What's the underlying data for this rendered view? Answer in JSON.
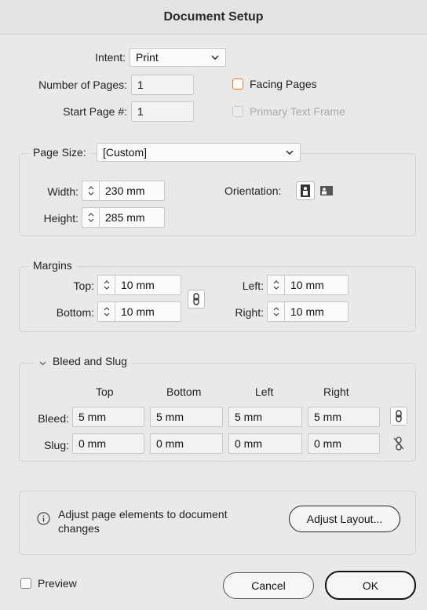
{
  "window": {
    "title": "Document Setup"
  },
  "intent": {
    "label": "Intent:",
    "value": "Print"
  },
  "pages": {
    "number_label": "Number of Pages:",
    "number_value": "1",
    "start_label": "Start Page #:",
    "start_value": "1",
    "facing_label": "Facing Pages",
    "facing_checked": false,
    "primary_label": "Primary Text Frame",
    "primary_checked": false,
    "primary_enabled": false
  },
  "page_size": {
    "label": "Page Size:",
    "value": "[Custom]",
    "width_label": "Width:",
    "width_value": "230 mm",
    "height_label": "Height:",
    "height_value": "285 mm",
    "orientation_label": "Orientation:",
    "orientation_selected": "portrait"
  },
  "margins": {
    "title": "Margins",
    "top_label": "Top:",
    "top_value": "10 mm",
    "bottom_label": "Bottom:",
    "bottom_value": "10 mm",
    "left_label": "Left:",
    "left_value": "10 mm",
    "right_label": "Right:",
    "right_value": "10 mm",
    "linked": true
  },
  "bleed_slug": {
    "title": "Bleed and Slug",
    "columns": [
      "Top",
      "Bottom",
      "Left",
      "Right"
    ],
    "bleed_label": "Bleed:",
    "bleed_values": [
      "5 mm",
      "5 mm",
      "5 mm",
      "5 mm"
    ],
    "slug_label": "Slug:",
    "slug_values": [
      "0 mm",
      "0 mm",
      "0 mm",
      "0 mm"
    ],
    "bleed_linked": true,
    "slug_linked": false
  },
  "adjust": {
    "message_line1": "Adjust page elements to document",
    "message_line2": "changes",
    "button_label": "Adjust Layout..."
  },
  "footer": {
    "preview_label": "Preview",
    "preview_checked": false,
    "cancel_label": "Cancel",
    "ok_label": "OK"
  },
  "colors": {
    "accent_checkbox": "#e07a2e",
    "background": "#e9e9e9"
  }
}
